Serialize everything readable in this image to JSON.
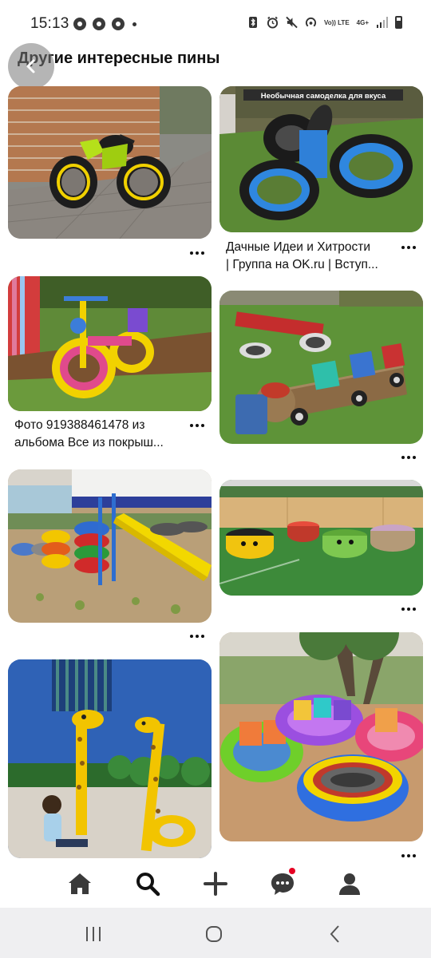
{
  "status_bar": {
    "time": "15:13",
    "left_icons": [
      "chrome-icon",
      "chrome-icon",
      "chrome-icon",
      "dot"
    ],
    "right_icons": [
      "bluetooth-icon",
      "alarm-icon",
      "mute-icon",
      "hotspot-icon",
      "volte-icon",
      "4g-icon",
      "signal-icon",
      "battery-icon"
    ],
    "volte_text": "Vo)) LTE",
    "network_text": "4G+"
  },
  "header": {
    "title": "Другие интересные пины"
  },
  "pins": [
    {
      "id": "pin-1",
      "caption": ""
    },
    {
      "id": "pin-2",
      "caption_line1": "Дачные Идеи и Хитрости",
      "caption_line2": "| Группа на OK.ru | Вступ...",
      "banner_text": "Необычная самоделка для вкуса"
    },
    {
      "id": "pin-3",
      "caption_line1": "Фото 919388461478 из",
      "caption_line2": "альбома Все из покрыш..."
    },
    {
      "id": "pin-4",
      "caption": ""
    },
    {
      "id": "pin-5",
      "caption": ""
    },
    {
      "id": "pin-6",
      "caption": ""
    },
    {
      "id": "pin-7",
      "caption": ""
    },
    {
      "id": "pin-8",
      "caption": ""
    }
  ],
  "bottom_nav": {
    "items": [
      "home-icon",
      "search-icon",
      "create-icon",
      "messages-icon",
      "profile-icon"
    ],
    "active": "search-icon"
  },
  "system_nav": {
    "items": [
      "recents-icon",
      "home-circle-icon",
      "back-icon"
    ]
  },
  "colors": {
    "accent": "#e60023",
    "nav_bg": "#efeff1"
  }
}
